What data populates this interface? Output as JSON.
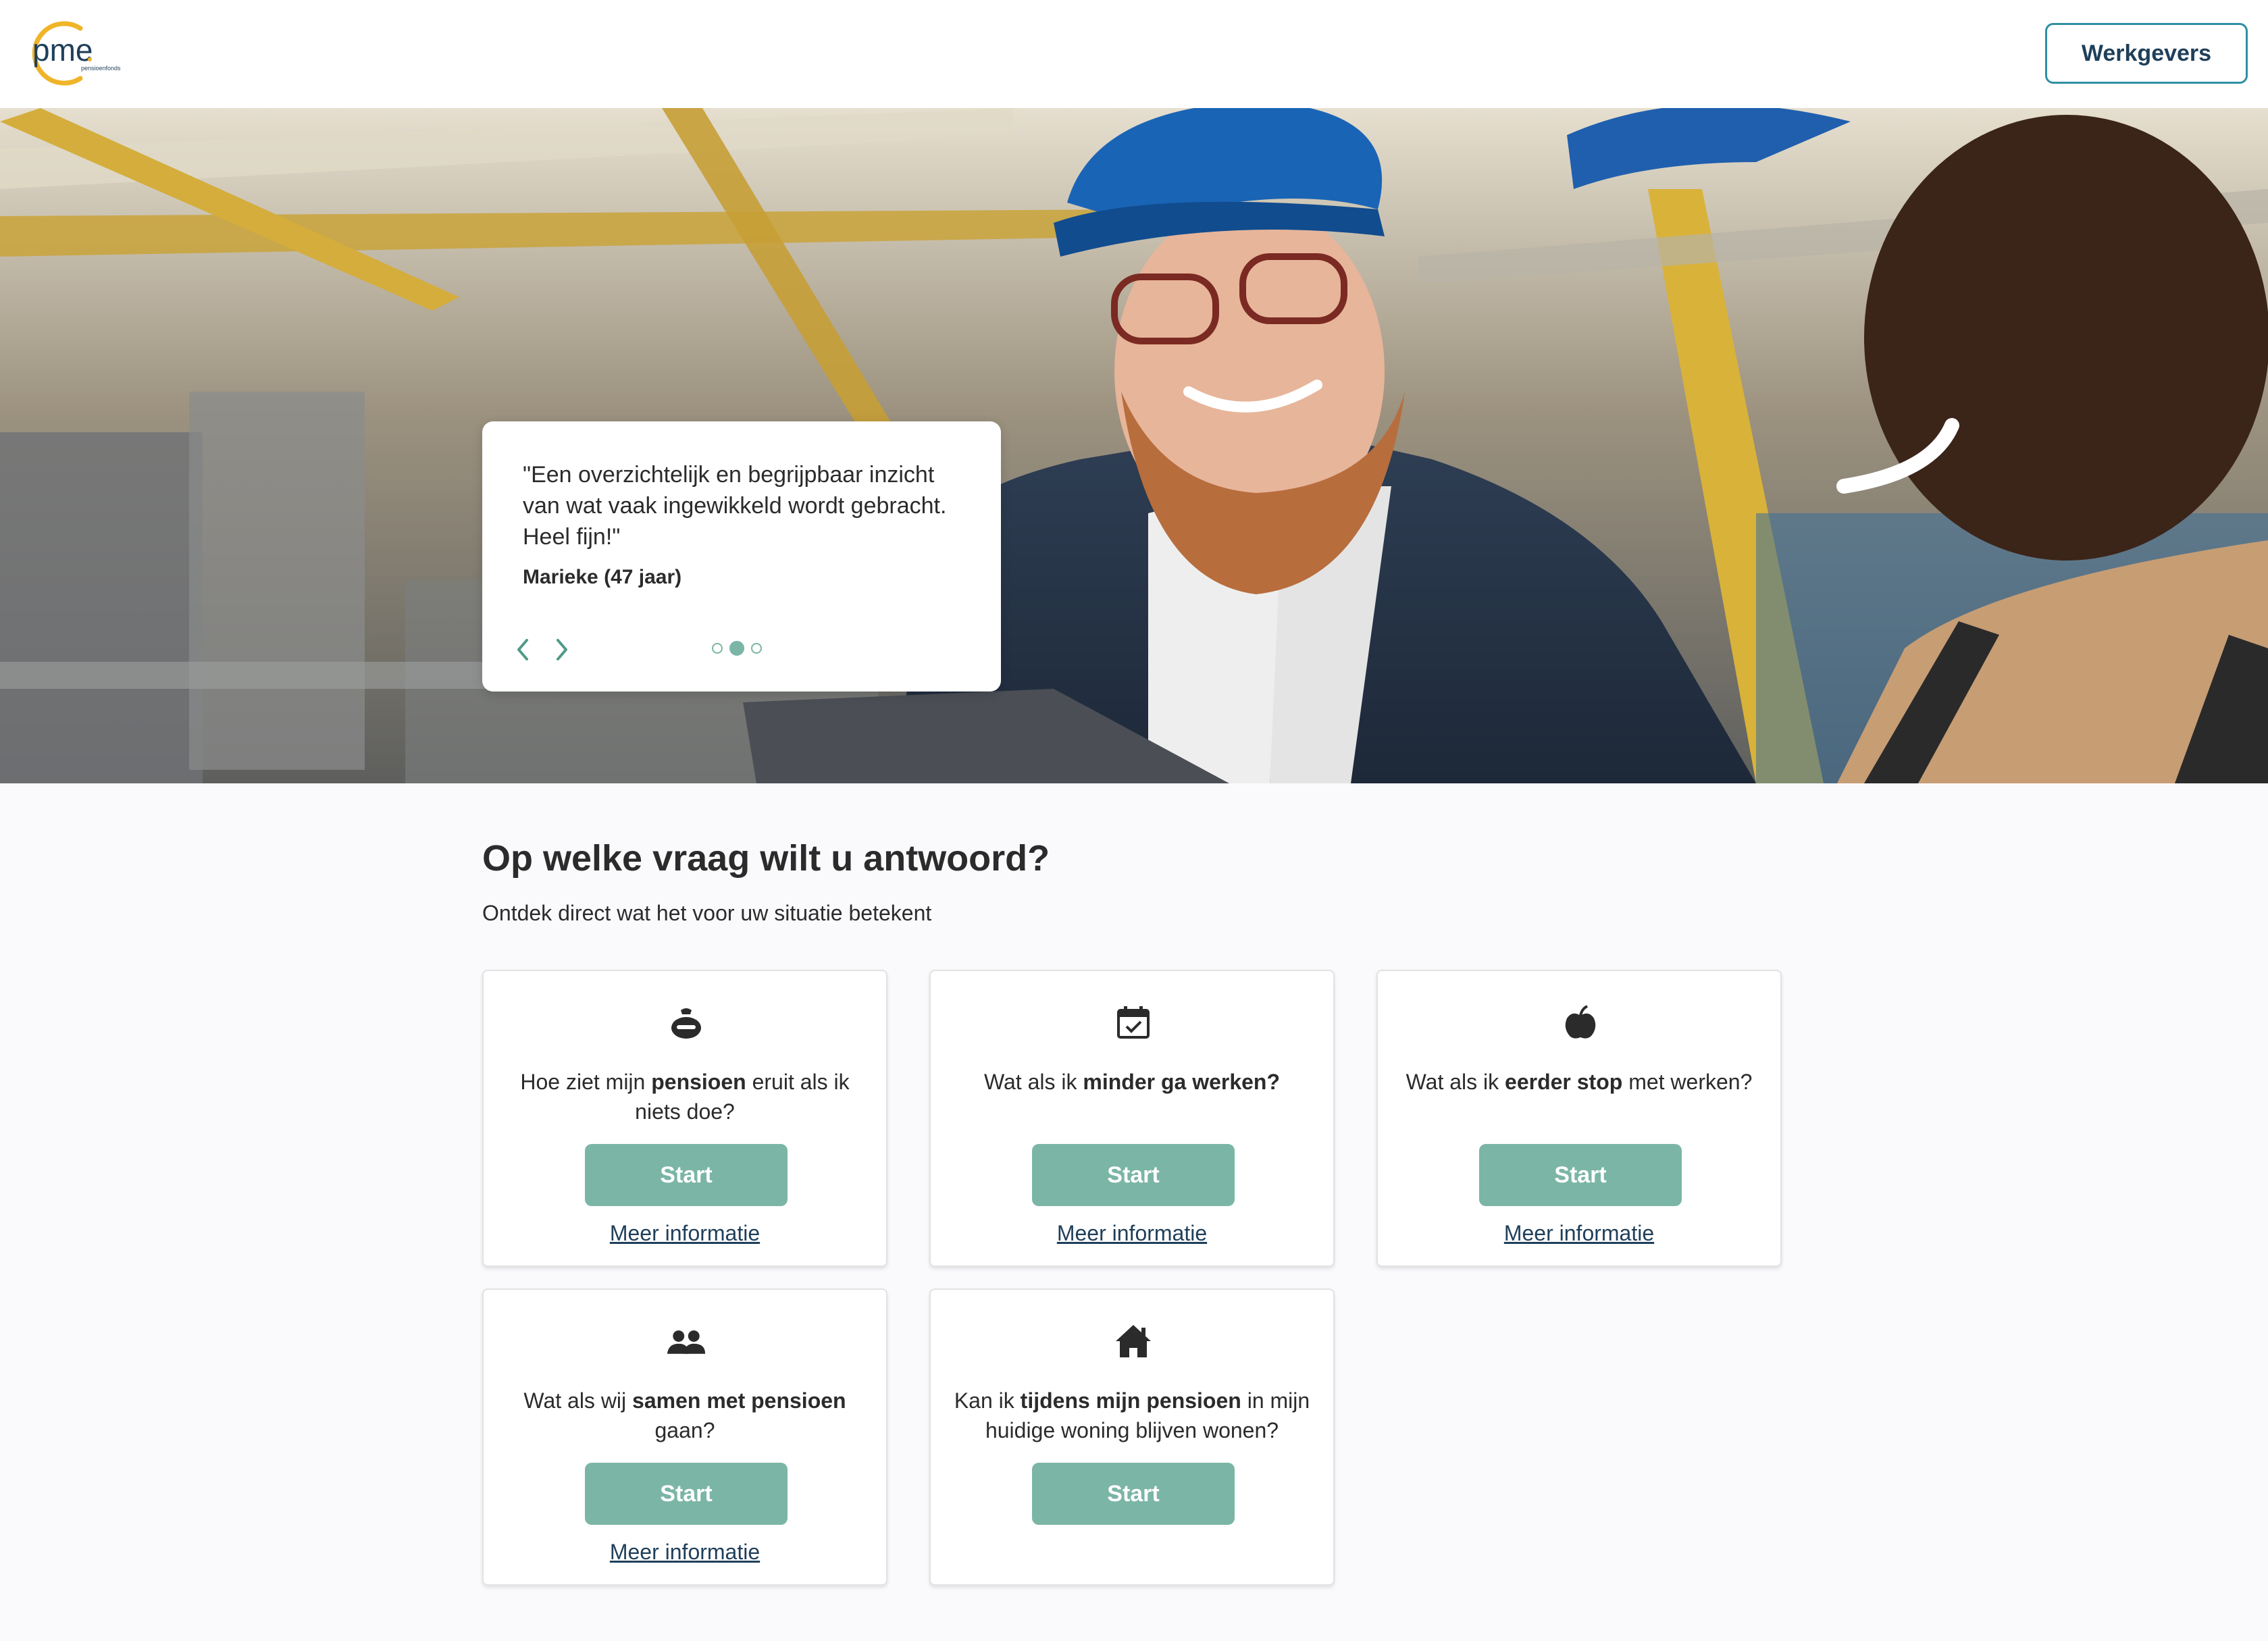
{
  "header": {
    "logo_text": "pme",
    "logo_subtext": "pensioenfonds",
    "employers_button": "Werkgevers"
  },
  "hero": {
    "quote": "\"Een overzichtelijk en begrijpbaar inzicht van wat vaak ingewikkeld wordt gebracht. Heel fijn!\"",
    "author": "Marieke (47 jaar)",
    "carousel": {
      "slides": 3,
      "active_slide": 2
    }
  },
  "main": {
    "title": "Op welke vraag wilt u antwoord?",
    "subtitle": "Ontdek direct wat het voor uw situatie betekent",
    "cards": [
      {
        "icon": "wallet-icon",
        "q_before": "Hoe ziet mijn ",
        "q_bold": "pensioen",
        "q_after": " eruit als ik niets doe?",
        "start": "Start",
        "more": "Meer informatie"
      },
      {
        "icon": "calendar-check-icon",
        "q_before": "Wat als ik ",
        "q_bold": "minder ga werken?",
        "q_after": "",
        "start": "Start",
        "more": "Meer informatie"
      },
      {
        "icon": "apple-icon",
        "q_before": "Wat als ik ",
        "q_bold": "eerder stop",
        "q_after": " met werken?",
        "start": "Start",
        "more": "Meer informatie"
      },
      {
        "icon": "people-icon",
        "q_before": "Wat als wij ",
        "q_bold": "samen met pensioen",
        "q_after": " gaan?",
        "start": "Start",
        "more": "Meer informatie"
      },
      {
        "icon": "house-icon",
        "q_before": "Kan ik ",
        "q_bold": "tijdens mijn pensioen",
        "q_after": " in mijn huidige woning blijven wonen?",
        "start": "Start",
        "more": ""
      }
    ]
  },
  "colors": {
    "accent_green": "#7bb5a5",
    "link_navy": "#1f3f5a",
    "button_border": "#2f8fa3",
    "logo_ring": "#f0b429"
  }
}
